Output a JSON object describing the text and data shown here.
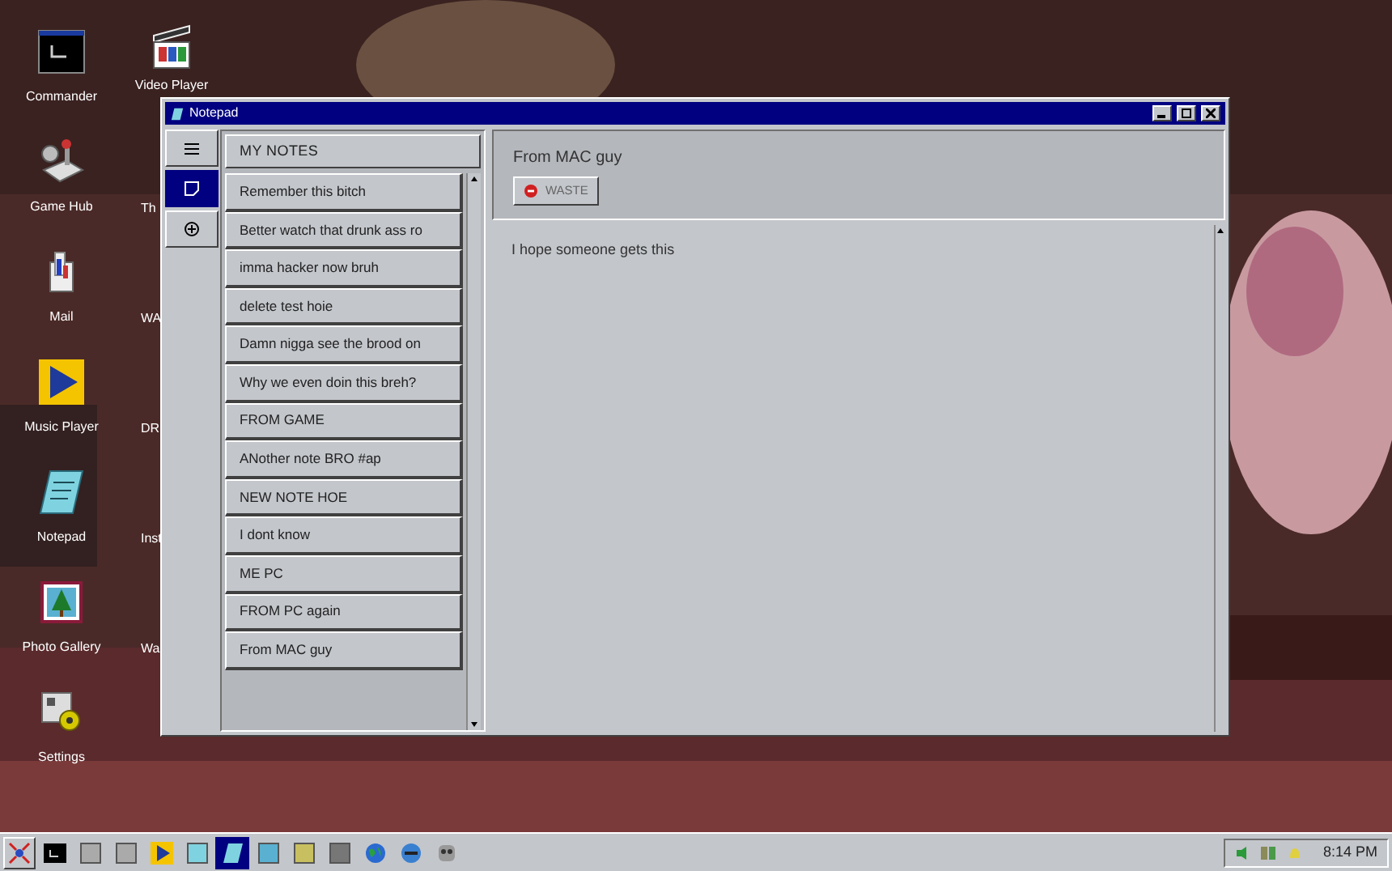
{
  "desktop_icons": [
    {
      "label": "Commander"
    },
    {
      "label": "Game Hub"
    },
    {
      "label": "Mail"
    },
    {
      "label": "Music Player"
    },
    {
      "label": "Notepad"
    },
    {
      "label": "Photo Gallery"
    },
    {
      "label": "Settings"
    }
  ],
  "desktop_icons_column_2": [
    {
      "label": "Video Player"
    },
    {
      "label": "Th"
    },
    {
      "label": "WA"
    },
    {
      "label": "DR"
    },
    {
      "label": "Inst"
    },
    {
      "label": "Wa"
    }
  ],
  "window": {
    "title": "Notepad"
  },
  "nav": [
    {
      "selected": false
    },
    {
      "selected": true
    },
    {
      "selected": false
    }
  ],
  "notes_panel": {
    "title": "MY NOTES",
    "notes": [
      "Remember this bitch",
      "Better watch that drunk ass ro",
      "imma hacker now bruh",
      "delete test hoie",
      "Damn nigga see the brood on",
      "Why we even doin this breh?",
      "FROM GAME",
      "ANother note BRO #ap",
      "NEW NOTE HOE",
      "I dont know",
      "ME PC",
      "FROM PC again",
      "From MAC guy"
    ]
  },
  "note": {
    "title": "From MAC guy",
    "delete_button": "WASTE",
    "body": "I hope someone gets this"
  },
  "taskbar": {
    "apps": [
      {
        "selected": false
      },
      {
        "selected": false
      },
      {
        "selected": false
      },
      {
        "selected": false
      },
      {
        "selected": false
      },
      {
        "selected": true
      },
      {
        "selected": false
      },
      {
        "selected": false
      },
      {
        "selected": false
      },
      {
        "selected": false
      },
      {
        "selected": false
      },
      {
        "selected": false
      }
    ],
    "clock": "8:14 PM"
  }
}
